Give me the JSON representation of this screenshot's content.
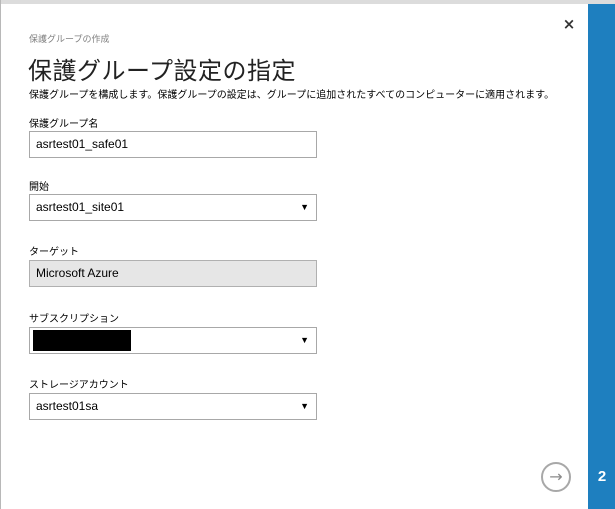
{
  "dialog": {
    "breadcrumb": "保護グループの作成",
    "title": "保護グループ設定の指定",
    "description": "保護グループを構成します。保護グループの設定は、グループに追加されたすべてのコンピューターに適用されます。",
    "close_glyph": "×",
    "step_number": "2",
    "next_glyph": "→"
  },
  "fields": {
    "group_name": {
      "label": "保護グループ名",
      "value": "asrtest01_safe01"
    },
    "source": {
      "label": "開始",
      "value": "asrtest01_site01"
    },
    "target": {
      "label": "ターゲット",
      "value": "Microsoft Azure"
    },
    "subscription": {
      "label": "サブスクリプション",
      "value": ""
    },
    "storage_account": {
      "label": "ストレージアカウント",
      "value": "asrtest01sa"
    }
  },
  "dropdown_glyph": "▼",
  "colors": {
    "side_rail": "#1e7fbf",
    "readonly_field": "#e6e6e6"
  }
}
